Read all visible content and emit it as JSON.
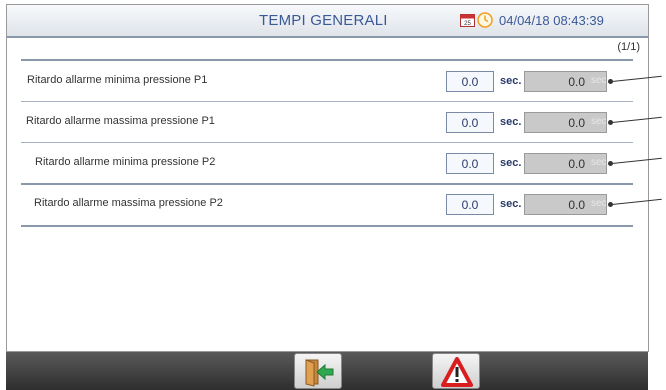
{
  "header": {
    "title": "TEMPI GENERALI",
    "datetime": "04/04/18 08:43:39",
    "calendar_icon_text": "25"
  },
  "page_indicator": "(1/1)",
  "rows": [
    {
      "label": "Ritardo allarme minima pressione P1",
      "value": "0.0",
      "unit": "sec.",
      "readback": "0.0",
      "readback_unit": "sec."
    },
    {
      "label": "Ritardo allarme massima pressione P1",
      "value": "0.0",
      "unit": "sec.",
      "readback": "0.0",
      "readback_unit": "sec."
    },
    {
      "label": "Ritardo allarme minima pressione P2",
      "value": "0.0",
      "unit": "sec.",
      "readback": "0.0",
      "readback_unit": "sec."
    },
    {
      "label": "Ritardo allarme massima pressione P2",
      "value": "0.0",
      "unit": "sec.",
      "readback": "0.0",
      "readback_unit": "sec."
    }
  ],
  "footer": {
    "buttons": [
      {
        "icon": "exit-door-icon"
      },
      {
        "icon": "alarm-warning-icon"
      }
    ]
  },
  "colors": {
    "title": "#3b5998",
    "footer": "#3a3a3a",
    "readback_bg": "#c9c9c9",
    "alarm_red": "#d81e1e",
    "exit_green": "#2fa84f"
  }
}
